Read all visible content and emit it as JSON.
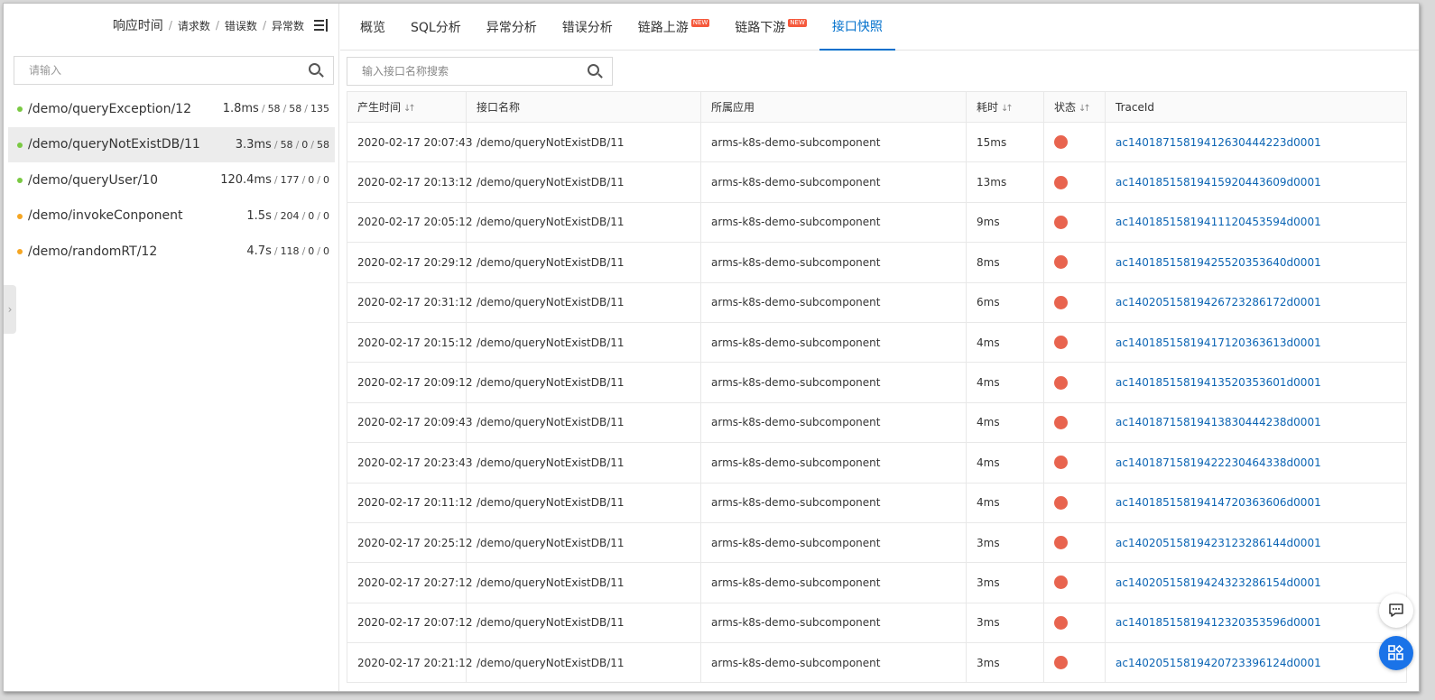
{
  "left_panel": {
    "header": {
      "metric_main": "响应时间",
      "metric_requests": "请求数",
      "metric_errors": "错误数",
      "metric_exceptions": "异常数",
      "separator": "/"
    },
    "search_placeholder": "请输入",
    "items": [
      {
        "name": "/demo/queryException/12",
        "rt": "1.8ms",
        "requests": "58",
        "errors": "58",
        "exceptions": "135",
        "dot_color": "#7ac943",
        "active": false
      },
      {
        "name": "/demo/queryNotExistDB/11",
        "rt": "3.3ms",
        "requests": "58",
        "errors": "0",
        "exceptions": "58",
        "dot_color": "#7ac943",
        "active": true
      },
      {
        "name": "/demo/queryUser/10",
        "rt": "120.4ms",
        "requests": "177",
        "errors": "0",
        "exceptions": "0",
        "dot_color": "#7ac943",
        "active": false
      },
      {
        "name": "/demo/invokeConponent",
        "rt": "1.5s",
        "requests": "204",
        "errors": "0",
        "exceptions": "0",
        "dot_color": "#f5a623",
        "active": false
      },
      {
        "name": "/demo/randomRT/12",
        "rt": "4.7s",
        "requests": "118",
        "errors": "0",
        "exceptions": "0",
        "dot_color": "#f5a623",
        "active": false
      }
    ]
  },
  "tabs": [
    {
      "label": "概览",
      "badge": "",
      "active": false
    },
    {
      "label": "SQL分析",
      "badge": "",
      "active": false
    },
    {
      "label": "异常分析",
      "badge": "",
      "active": false
    },
    {
      "label": "错误分析",
      "badge": "",
      "active": false
    },
    {
      "label": "链路上游",
      "badge": "NEW",
      "active": false
    },
    {
      "label": "链路下游",
      "badge": "NEW",
      "active": false
    },
    {
      "label": "接口快照",
      "badge": "",
      "active": true
    }
  ],
  "right_search_placeholder": "输入接口名称搜索",
  "table": {
    "columns": [
      {
        "label": "产生时间",
        "sortable": true
      },
      {
        "label": "接口名称",
        "sortable": false
      },
      {
        "label": "所属应用",
        "sortable": false
      },
      {
        "label": "耗时",
        "sortable": true
      },
      {
        "label": "状态",
        "sortable": true
      },
      {
        "label": "TraceId",
        "sortable": false
      }
    ],
    "rows": [
      {
        "time": "2020-02-17 20:07:43",
        "api": "/demo/queryNotExistDB/11",
        "app": "arms-k8s-demo-subcomponent",
        "cost": "15ms",
        "trace": "ac14018715819412630444223d0001"
      },
      {
        "time": "2020-02-17 20:13:12",
        "api": "/demo/queryNotExistDB/11",
        "app": "arms-k8s-demo-subcomponent",
        "cost": "13ms",
        "trace": "ac14018515819415920443609d0001"
      },
      {
        "time": "2020-02-17 20:05:12",
        "api": "/demo/queryNotExistDB/11",
        "app": "arms-k8s-demo-subcomponent",
        "cost": "9ms",
        "trace": "ac14018515819411120453594d0001"
      },
      {
        "time": "2020-02-17 20:29:12",
        "api": "/demo/queryNotExistDB/11",
        "app": "arms-k8s-demo-subcomponent",
        "cost": "8ms",
        "trace": "ac14018515819425520353640d0001"
      },
      {
        "time": "2020-02-17 20:31:12",
        "api": "/demo/queryNotExistDB/11",
        "app": "arms-k8s-demo-subcomponent",
        "cost": "6ms",
        "trace": "ac14020515819426723286172d0001"
      },
      {
        "time": "2020-02-17 20:15:12",
        "api": "/demo/queryNotExistDB/11",
        "app": "arms-k8s-demo-subcomponent",
        "cost": "4ms",
        "trace": "ac14018515819417120363613d0001"
      },
      {
        "time": "2020-02-17 20:09:12",
        "api": "/demo/queryNotExistDB/11",
        "app": "arms-k8s-demo-subcomponent",
        "cost": "4ms",
        "trace": "ac14018515819413520353601d0001"
      },
      {
        "time": "2020-02-17 20:09:43",
        "api": "/demo/queryNotExistDB/11",
        "app": "arms-k8s-demo-subcomponent",
        "cost": "4ms",
        "trace": "ac14018715819413830444238d0001"
      },
      {
        "time": "2020-02-17 20:23:43",
        "api": "/demo/queryNotExistDB/11",
        "app": "arms-k8s-demo-subcomponent",
        "cost": "4ms",
        "trace": "ac14018715819422230464338d0001"
      },
      {
        "time": "2020-02-17 20:11:12",
        "api": "/demo/queryNotExistDB/11",
        "app": "arms-k8s-demo-subcomponent",
        "cost": "4ms",
        "trace": "ac14018515819414720363606d0001"
      },
      {
        "time": "2020-02-17 20:25:12",
        "api": "/demo/queryNotExistDB/11",
        "app": "arms-k8s-demo-subcomponent",
        "cost": "3ms",
        "trace": "ac14020515819423123286144d0001"
      },
      {
        "time": "2020-02-17 20:27:12",
        "api": "/demo/queryNotExistDB/11",
        "app": "arms-k8s-demo-subcomponent",
        "cost": "3ms",
        "trace": "ac14020515819424323286154d0001"
      },
      {
        "time": "2020-02-17 20:07:12",
        "api": "/demo/queryNotExistDB/11",
        "app": "arms-k8s-demo-subcomponent",
        "cost": "3ms",
        "trace": "ac14018515819412320353596d0001"
      },
      {
        "time": "2020-02-17 20:21:12",
        "api": "/demo/queryNotExistDB/11",
        "app": "arms-k8s-demo-subcomponent",
        "cost": "3ms",
        "trace": "ac14020515819420723396124d0001"
      }
    ]
  },
  "colors": {
    "accent": "#0070cc",
    "status_error": "#e8644f",
    "link": "#0b64b4",
    "badge_new": "#f5583b",
    "floating_apps_button": "#1a73e8"
  },
  "icons": {
    "left_sort": "sort-list-icon",
    "search": "search-icon",
    "collapse": "chevron-right-icon",
    "chat": "chat-icon",
    "apps": "apps-grid-icon"
  }
}
